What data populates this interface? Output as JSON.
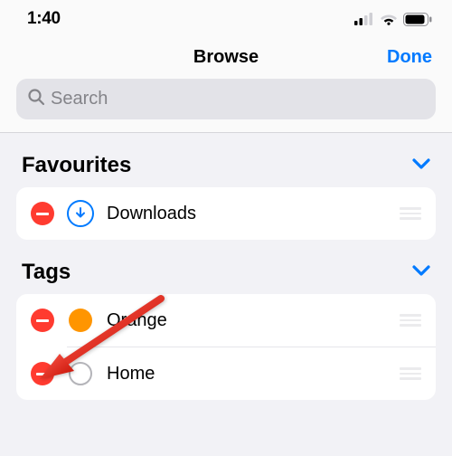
{
  "status": {
    "time": "1:40"
  },
  "nav": {
    "title": "Browse",
    "done": "Done"
  },
  "search": {
    "placeholder": "Search"
  },
  "sections": {
    "favourites": {
      "title": "Favourites",
      "items": [
        {
          "label": "Downloads"
        }
      ]
    },
    "tags": {
      "title": "Tags",
      "items": [
        {
          "label": "Orange"
        },
        {
          "label": "Home"
        }
      ]
    }
  }
}
